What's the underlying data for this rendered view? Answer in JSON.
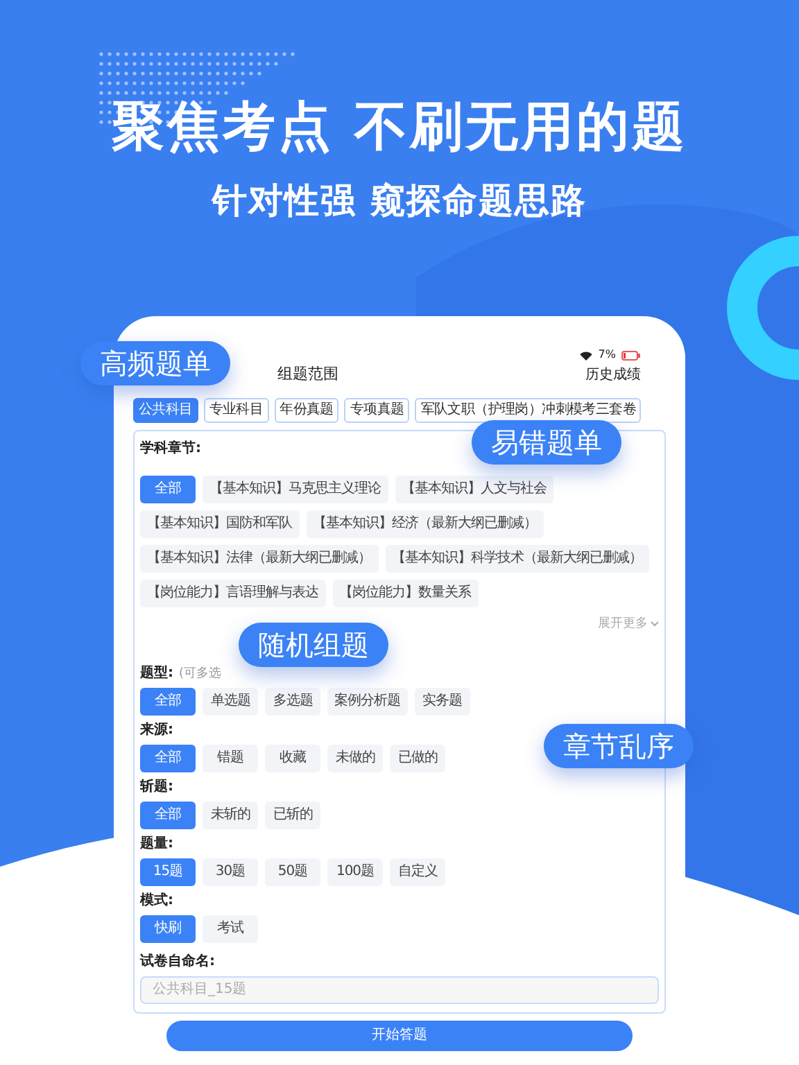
{
  "headline": "聚焦考点 不刷无用的题",
  "subheadline": "针对性强 窥探命题思路",
  "device": {
    "status_bar": {
      "battery": "7%"
    },
    "title": "组题范围",
    "history_link": "历史成绩",
    "subject_tabs": [
      {
        "label": "公共科目",
        "selected": true
      },
      {
        "label": "专业科目",
        "selected": false
      },
      {
        "label": "年份真题",
        "selected": false
      },
      {
        "label": "专项真题",
        "selected": false
      },
      {
        "label": "军队文职（护理岗）冲刺模考三套卷",
        "selected": false
      }
    ],
    "chapters": {
      "label": "学科章节:",
      "expand": "展开更多",
      "options": [
        {
          "label": "全部",
          "selected": true
        },
        {
          "label": "【基本知识】马克思主义理论",
          "selected": false
        },
        {
          "label": "【基本知识】人文与社会",
          "selected": false
        },
        {
          "label": "【基本知识】国防和军队",
          "selected": false
        },
        {
          "label": "【基本知识】经济（最新大纲已删减）",
          "selected": false
        },
        {
          "label": "【基本知识】法律（最新大纲已删减）",
          "selected": false
        },
        {
          "label": "【基本知识】科学技术（最新大纲已删减）",
          "selected": false
        },
        {
          "label": "【岗位能力】言语理解与表达",
          "selected": false
        },
        {
          "label": "【岗位能力】数量关系",
          "selected": false
        }
      ]
    },
    "sections": [
      {
        "label": "题型:",
        "hint": "(可多选",
        "options": [
          {
            "label": "全部",
            "selected": true
          },
          {
            "label": "单选题",
            "selected": false
          },
          {
            "label": "多选题",
            "selected": false
          },
          {
            "label": "案例分析题",
            "selected": false
          },
          {
            "label": "实务题",
            "selected": false
          }
        ]
      },
      {
        "label": "来源:",
        "options": [
          {
            "label": "全部",
            "selected": true
          },
          {
            "label": "错题",
            "selected": false
          },
          {
            "label": "收藏",
            "selected": false
          },
          {
            "label": "未做的",
            "selected": false
          },
          {
            "label": "已做的",
            "selected": false
          }
        ]
      },
      {
        "label": "斩题:",
        "options": [
          {
            "label": "全部",
            "selected": true
          },
          {
            "label": "未斩的",
            "selected": false
          },
          {
            "label": "已斩的",
            "selected": false
          }
        ]
      },
      {
        "label": "题量:",
        "options": [
          {
            "label": "15题",
            "selected": true
          },
          {
            "label": "30题",
            "selected": false
          },
          {
            "label": "50题",
            "selected": false
          },
          {
            "label": "100题",
            "selected": false
          },
          {
            "label": "自定义",
            "selected": false
          }
        ]
      },
      {
        "label": "模式:",
        "options": [
          {
            "label": "快刷",
            "selected": true
          },
          {
            "label": "考试",
            "selected": false
          }
        ]
      }
    ],
    "name_field": {
      "label": "试卷自命名:",
      "placeholder": "公共科目_15题"
    },
    "start_button": "开始答题"
  },
  "callouts": [
    "高频题单",
    "易错题单",
    "随机组题",
    "章节乱序"
  ]
}
